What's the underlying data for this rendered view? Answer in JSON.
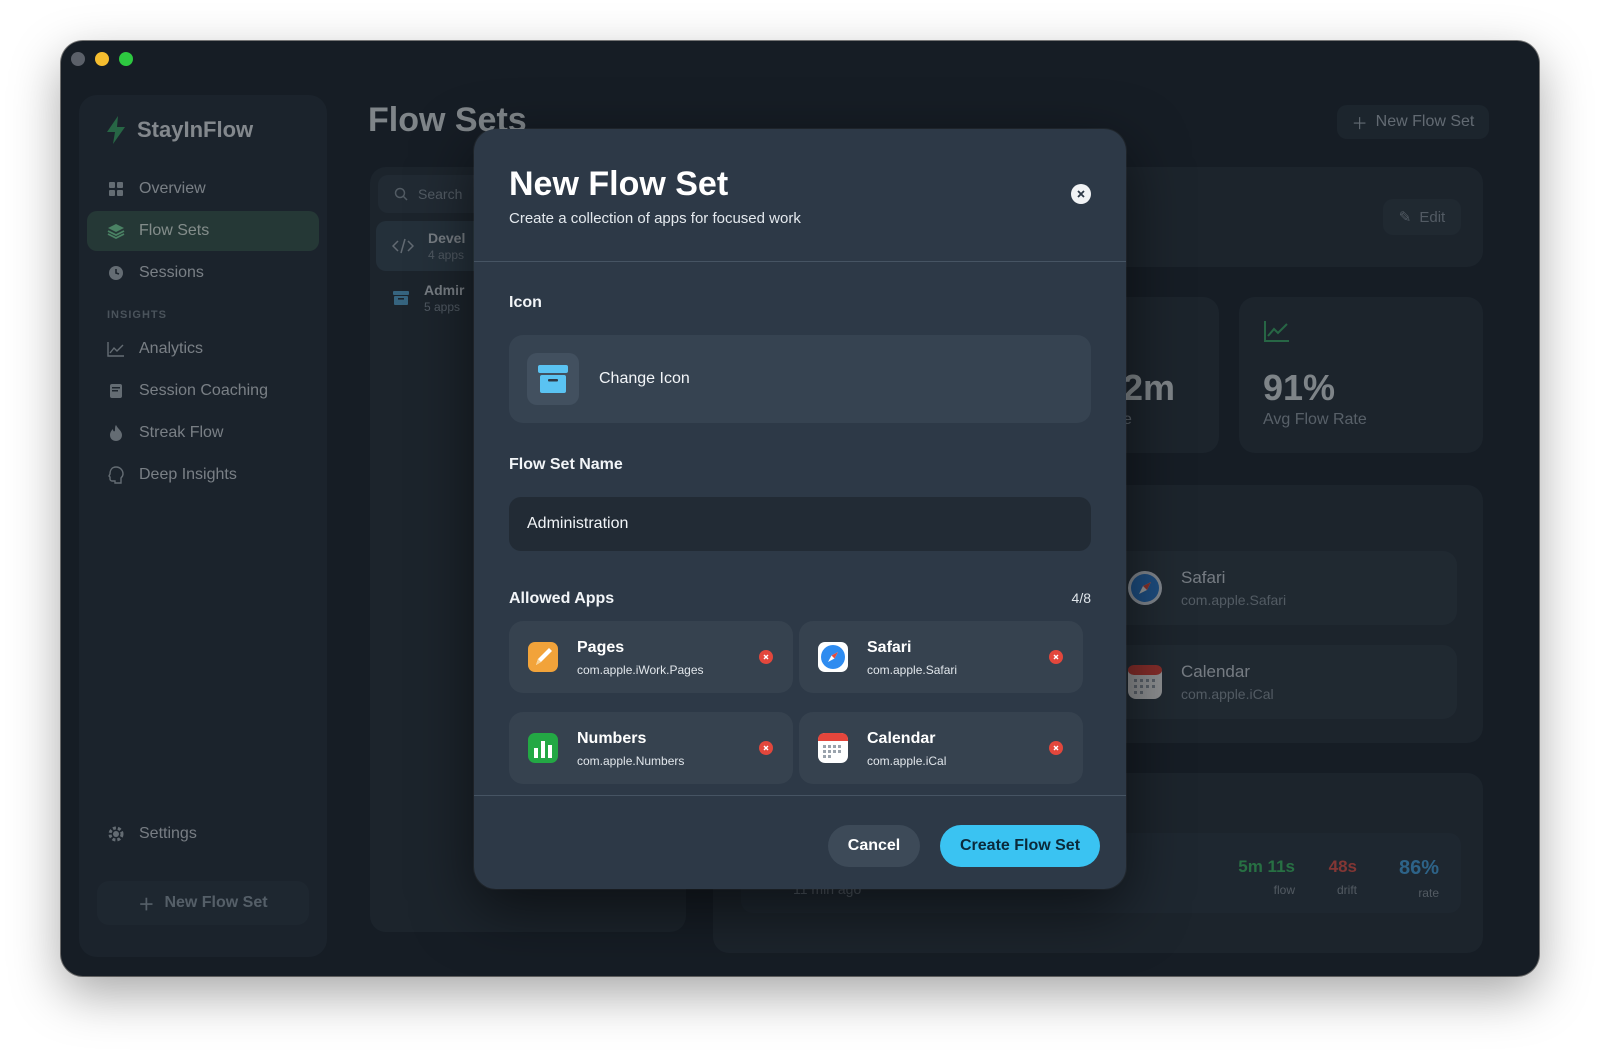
{
  "app": {
    "name": "StayInFlow"
  },
  "sidebar": {
    "items": [
      {
        "label": "Overview",
        "icon": "grid-icon"
      },
      {
        "label": "Flow Sets",
        "icon": "layers-icon",
        "active": true
      },
      {
        "label": "Sessions",
        "icon": "clock-icon"
      }
    ],
    "insights_header": "INSIGHTS",
    "insights": [
      {
        "label": "Analytics",
        "icon": "line-chart-icon"
      },
      {
        "label": "Session Coaching",
        "icon": "book-icon"
      },
      {
        "label": "Streak Flow",
        "icon": "flame-icon"
      },
      {
        "label": "Deep Insights",
        "icon": "brain-icon"
      }
    ],
    "settings_label": "Settings",
    "new_button_label": "New Flow Set"
  },
  "main": {
    "title": "Flow Sets",
    "new_button_label": "New Flow Set",
    "search_placeholder": "Search",
    "flow_sets": [
      {
        "name": "Devel",
        "count": "4 apps",
        "icon": "code-icon"
      },
      {
        "name": "Admir",
        "count": "5 apps",
        "icon": "archive-icon"
      }
    ],
    "edit_label": "Edit",
    "stats": [
      {
        "value": "2m",
        "label": "e"
      },
      {
        "value": "91%",
        "label": "Avg Flow Rate"
      }
    ],
    "apps": [
      {
        "name": "Safari",
        "bundle": "com.apple.Safari"
      },
      {
        "name": "Calendar",
        "bundle": "com.apple.iCal"
      }
    ],
    "session": {
      "time": "11 min ago",
      "metrics": [
        {
          "value": "5m 11s",
          "label": "flow",
          "color": "#3fbf6a"
        },
        {
          "value": "48s",
          "label": "drift",
          "color": "#e5574f"
        },
        {
          "value": "86%",
          "label": "rate",
          "color": "#4aa8e8"
        }
      ]
    }
  },
  "modal": {
    "title": "New Flow Set",
    "subtitle": "Create a collection of apps for focused work",
    "icon_section_label": "Icon",
    "change_icon_label": "Change Icon",
    "name_section_label": "Flow Set Name",
    "name_value": "Administration",
    "apps_section_label": "Allowed Apps",
    "apps_count": "4/8",
    "apps": [
      {
        "name": "Pages",
        "bundle": "com.apple.iWork.Pages",
        "icon": "pages-icon"
      },
      {
        "name": "Safari",
        "bundle": "com.apple.Safari",
        "icon": "safari-icon"
      },
      {
        "name": "Numbers",
        "bundle": "com.apple.Numbers",
        "icon": "numbers-icon"
      },
      {
        "name": "Calendar",
        "bundle": "com.apple.iCal",
        "icon": "calendar-icon"
      }
    ],
    "cancel_label": "Cancel",
    "create_label": "Create Flow Set"
  },
  "colors": {
    "accent": "#3ac3f2",
    "active_nav": "#3b5a52",
    "remove": "#e3473c"
  }
}
